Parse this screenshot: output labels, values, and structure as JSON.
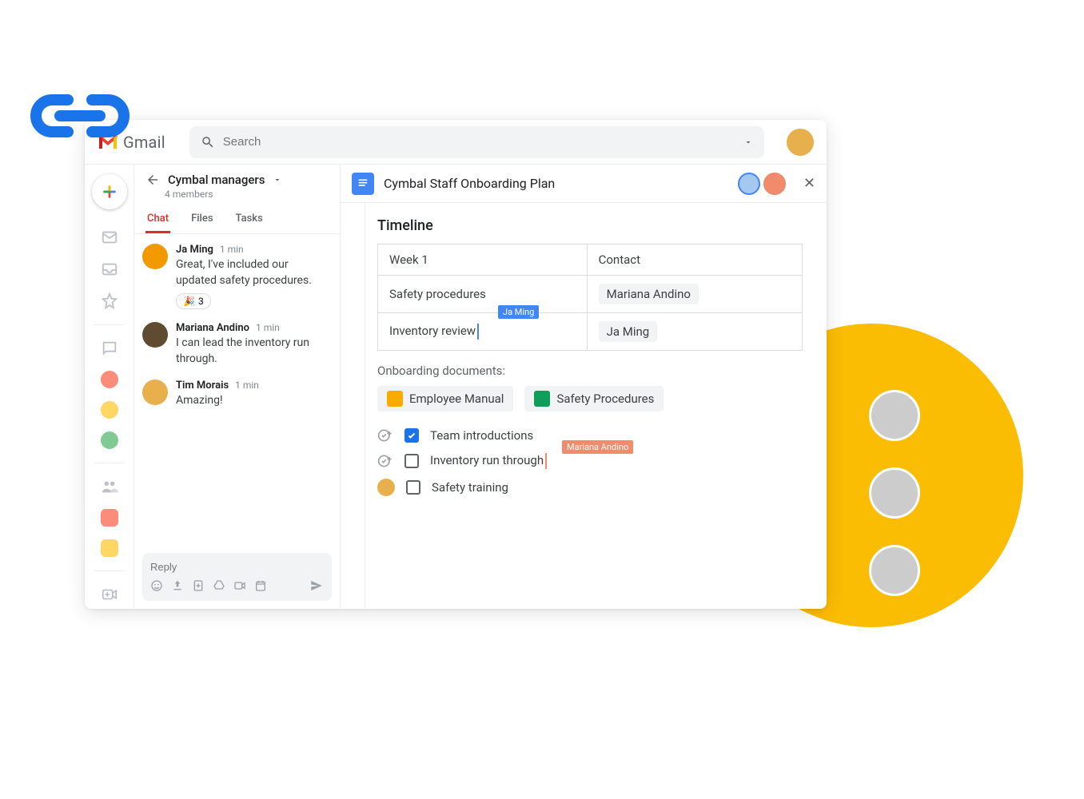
{
  "header": {
    "product": "Gmail",
    "search_placeholder": "Search"
  },
  "chat": {
    "room_name": "Cymbal managers",
    "members": "4 members",
    "tabs": [
      "Chat",
      "Files",
      "Tasks"
    ],
    "active_tab": "Chat",
    "messages": [
      {
        "name": "Ja Ming",
        "time": "1 min",
        "text": "Great, I've included our updated safety procedures.",
        "reaction_emoji": "🎉",
        "reaction_count": "3"
      },
      {
        "name": "Mariana Andino",
        "time": "1 min",
        "text": "I can lead the inventory run through."
      },
      {
        "name": "Tim Morais",
        "time": "1 min",
        "text": "Amazing!"
      }
    ],
    "reply_placeholder": "Reply"
  },
  "doc": {
    "title": "Cymbal Staff Onboarding Plan",
    "section": "Timeline",
    "table": {
      "h1": "Week 1",
      "h2": "Contact",
      "r1c1": "Safety procedures",
      "r1c2": "Mariana Andino",
      "r2c1": "Inventory review",
      "r2c2": "Ja Ming",
      "cursor1_label": "Ja Ming"
    },
    "onboarding_label": "Onboarding documents:",
    "links": {
      "slides": "Employee Manual",
      "sheets": "Safety Procedures"
    },
    "checks": {
      "c1": "Team introductions",
      "c2": "Inventory run through",
      "c2_cursor": "Mariana Andino",
      "c3": "Safety training"
    }
  }
}
